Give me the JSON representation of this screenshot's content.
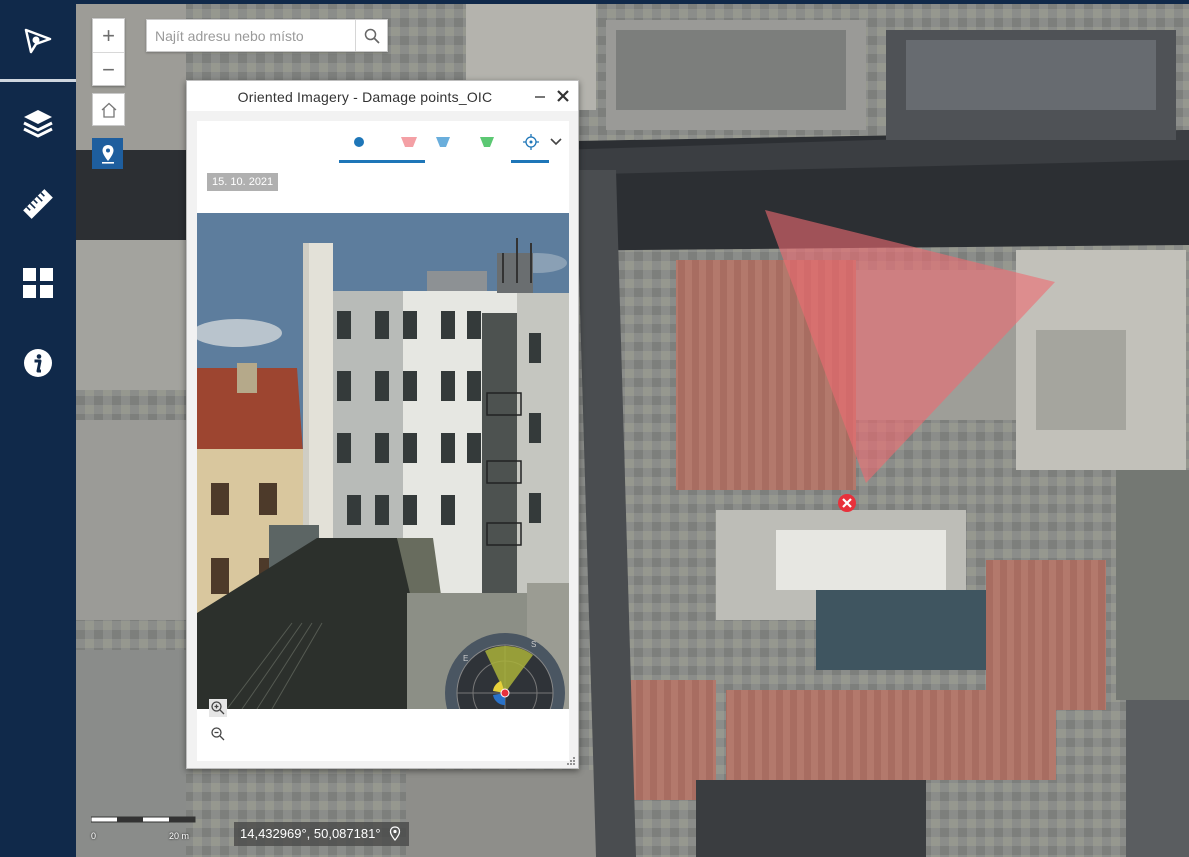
{
  "search": {
    "placeholder": "Najít adresu nebo místo"
  },
  "panel": {
    "title": "Oriented Imagery - Damage points_OIC",
    "date": "15. 10. 2021",
    "tabs": [
      {
        "icon": "dot-marker-icon",
        "color": "#1e76b8",
        "active": true
      },
      {
        "icon": "footprint-red-icon",
        "color": "#f4a0a5",
        "active": false
      },
      {
        "icon": "footprint-blue-icon",
        "color": "#6aaedc",
        "active": false
      },
      {
        "icon": "footprint-green-icon",
        "color": "#5cc873",
        "active": false
      },
      {
        "icon": "crosshair-icon",
        "color": "#1e76b8",
        "active": true
      }
    ],
    "compass": {
      "labels": [
        "E",
        "S",
        "N",
        "W"
      ]
    }
  },
  "scale": {
    "start": "0",
    "end": "20 m"
  },
  "coords": {
    "text": "14,432969°, 50,087181°"
  },
  "colors": {
    "sidebar": "#10294a",
    "accent": "#1e76b8",
    "footprint": "#ef6b72"
  }
}
